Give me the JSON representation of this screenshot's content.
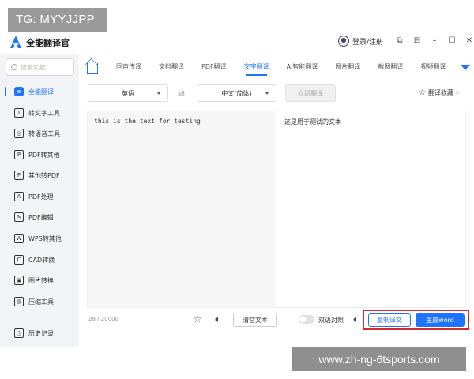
{
  "watermark": {
    "tg": "TG: MYYJJPP",
    "site": "www.zh-ng-6tsports.com"
  },
  "app": {
    "title": "全能翻译官",
    "login": "登录/注册"
  },
  "window_controls": [
    "⧉",
    "⊟",
    "–",
    "☐",
    "✕"
  ],
  "sidebar": {
    "search_placeholder": "搜索功能",
    "items": [
      {
        "label": "全能翻译",
        "icon": "translate-icon",
        "glyph": "≡",
        "active": true
      },
      {
        "label": "转文字工具",
        "icon": "text-tool-icon",
        "glyph": "T"
      },
      {
        "label": "转语音工具",
        "icon": "voice-tool-icon",
        "glyph": "◎"
      },
      {
        "label": "PDF转其他",
        "icon": "pdf-convert-icon",
        "glyph": "P"
      },
      {
        "label": "其他转PDF",
        "icon": "to-pdf-icon",
        "glyph": "P"
      },
      {
        "label": "PDF处理",
        "icon": "pdf-process-icon",
        "glyph": "A"
      },
      {
        "label": "PDF编辑",
        "icon": "pdf-edit-icon",
        "glyph": "✎"
      },
      {
        "label": "WPS转其他",
        "icon": "wps-icon",
        "glyph": "W"
      },
      {
        "label": "CAD转换",
        "icon": "cad-icon",
        "glyph": "C"
      },
      {
        "label": "图片转换",
        "icon": "image-convert-icon",
        "glyph": "▣"
      },
      {
        "label": "压缩工具",
        "icon": "compress-icon",
        "glyph": "▤"
      }
    ],
    "history": {
      "label": "历史记录",
      "icon": "history-icon",
      "glyph": "◷"
    }
  },
  "tabs": [
    {
      "label": "同声传译"
    },
    {
      "label": "文档翻译"
    },
    {
      "label": "PDF翻译"
    },
    {
      "label": "文字翻译",
      "active": true
    },
    {
      "label": "AI智能翻译"
    },
    {
      "label": "图片翻译"
    },
    {
      "label": "截图翻译"
    },
    {
      "label": "视频翻译"
    }
  ],
  "translate_bar": {
    "source_lang": "英语",
    "target_lang": "中文(简体)",
    "translate_button": "立即翻译",
    "favorites": "翻译收藏"
  },
  "source": {
    "text": "this is the text for testing",
    "count": "28 / 20000"
  },
  "target": {
    "text": "这是用于测试的文本"
  },
  "bottom": {
    "clear": "清空文本",
    "bilingual": "双语对照",
    "copy": "复制译文",
    "word": "生成word"
  },
  "colors": {
    "accent": "#1e74ff",
    "highlight": "#d62b2b"
  }
}
